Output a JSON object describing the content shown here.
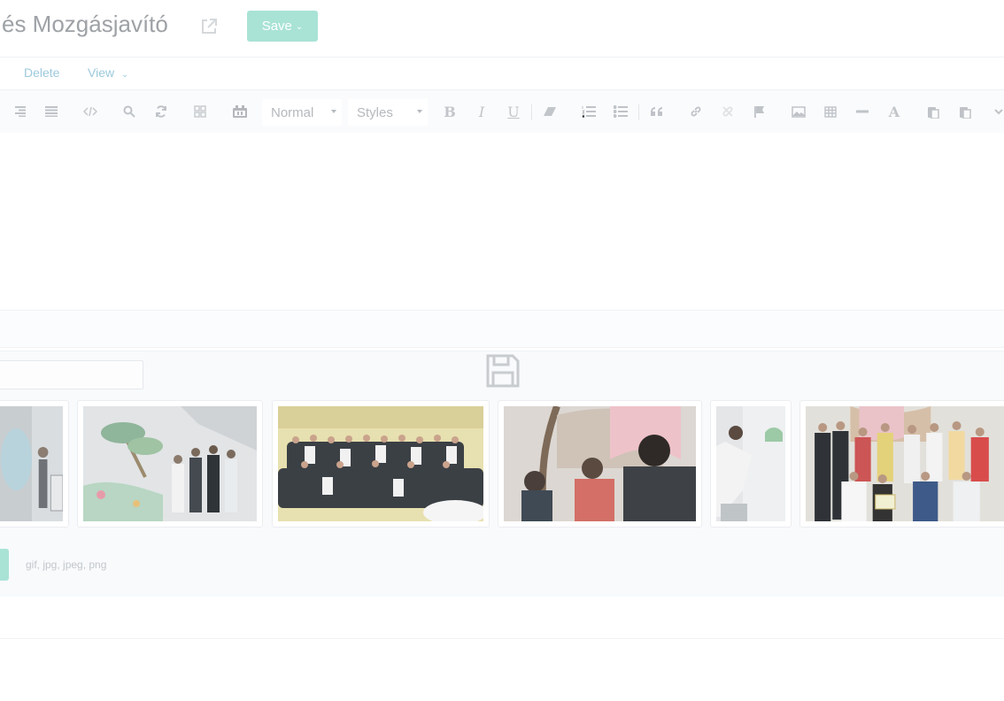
{
  "header": {
    "title": "és Mozgásjavító",
    "save_label": "Save"
  },
  "actions": [
    {
      "label": "Delete"
    },
    {
      "label": "View"
    }
  ],
  "toolbar": {
    "format_select": "Normal",
    "styles_select": "Styles",
    "bold": "B",
    "italic": "I",
    "underline": "U",
    "font_color": "A"
  },
  "gallery": {
    "allowed_types": "gif, jpg, jpeg, png",
    "thumbnails": 6
  },
  "colors": {
    "accent": "#a9e3d6",
    "link": "#9cc9dd",
    "muted": "#bfc3c8"
  }
}
